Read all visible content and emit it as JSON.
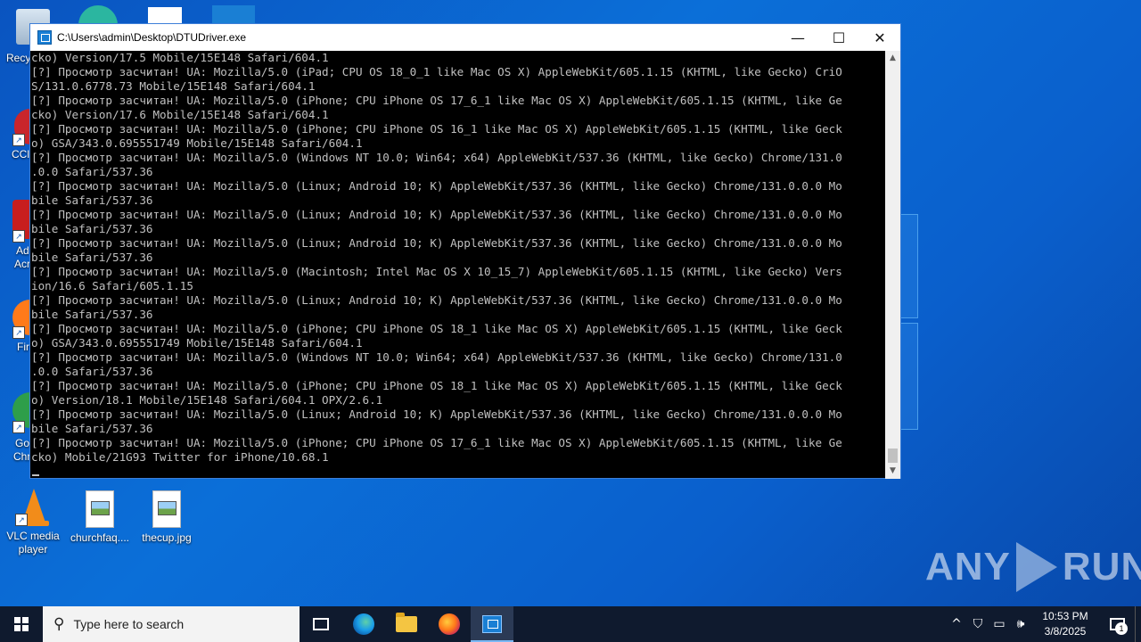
{
  "window": {
    "title": "C:\\Users\\admin\\Desktop\\DTUDriver.exe",
    "minimize_glyph": "—",
    "maximize_glyph": "☐",
    "close_glyph": "✕"
  },
  "console": {
    "lines": [
      "cko) Version/17.5 Mobile/15E148 Safari/604.1",
      "[?] Просмотр засчитан! UA: Mozilla/5.0 (iPad; CPU OS 18_0_1 like Mac OS X) AppleWebKit/605.1.15 (KHTML, like Gecko) CriO",
      "S/131.0.6778.73 Mobile/15E148 Safari/604.1",
      "[?] Просмотр засчитан! UA: Mozilla/5.0 (iPhone; CPU iPhone OS 17_6_1 like Mac OS X) AppleWebKit/605.1.15 (KHTML, like Ge",
      "cko) Version/17.6 Mobile/15E148 Safari/604.1",
      "[?] Просмотр засчитан! UA: Mozilla/5.0 (iPhone; CPU iPhone OS 16_1 like Mac OS X) AppleWebKit/605.1.15 (KHTML, like Geck",
      "o) GSA/343.0.695551749 Mobile/15E148 Safari/604.1",
      "[?] Просмотр засчитан! UA: Mozilla/5.0 (Windows NT 10.0; Win64; x64) AppleWebKit/537.36 (KHTML, like Gecko) Chrome/131.0",
      ".0.0 Safari/537.36",
      "[?] Просмотр засчитан! UA: Mozilla/5.0 (Linux; Android 10; K) AppleWebKit/537.36 (KHTML, like Gecko) Chrome/131.0.0.0 Mo",
      "bile Safari/537.36",
      "[?] Просмотр засчитан! UA: Mozilla/5.0 (Linux; Android 10; K) AppleWebKit/537.36 (KHTML, like Gecko) Chrome/131.0.0.0 Mo",
      "bile Safari/537.36",
      "[?] Просмотр засчитан! UA: Mozilla/5.0 (Linux; Android 10; K) AppleWebKit/537.36 (KHTML, like Gecko) Chrome/131.0.0.0 Mo",
      "bile Safari/537.36",
      "[?] Просмотр засчитан! UA: Mozilla/5.0 (Macintosh; Intel Mac OS X 10_15_7) AppleWebKit/605.1.15 (KHTML, like Gecko) Vers",
      "ion/16.6 Safari/605.1.15",
      "[?] Просмотр засчитан! UA: Mozilla/5.0 (Linux; Android 10; K) AppleWebKit/537.36 (KHTML, like Gecko) Chrome/131.0.0.0 Mo",
      "bile Safari/537.36",
      "[?] Просмотр засчитан! UA: Mozilla/5.0 (iPhone; CPU iPhone OS 18_1 like Mac OS X) AppleWebKit/605.1.15 (KHTML, like Geck",
      "o) GSA/343.0.695551749 Mobile/15E148 Safari/604.1",
      "[?] Просмотр засчитан! UA: Mozilla/5.0 (Windows NT 10.0; Win64; x64) AppleWebKit/537.36 (KHTML, like Gecko) Chrome/131.0",
      ".0.0 Safari/537.36",
      "[?] Просмотр засчитан! UA: Mozilla/5.0 (iPhone; CPU iPhone OS 18_1 like Mac OS X) AppleWebKit/605.1.15 (KHTML, like Geck",
      "o) Version/18.1 Mobile/15E148 Safari/604.1 OPX/2.6.1",
      "[?] Просмотр засчитан! UA: Mozilla/5.0 (Linux; Android 10; K) AppleWebKit/537.36 (KHTML, like Gecko) Chrome/131.0.0.0 Mo",
      "bile Safari/537.36",
      "[?] Просмотр засчитан! UA: Mozilla/5.0 (iPhone; CPU iPhone OS 17_6_1 like Mac OS X) AppleWebKit/605.1.15 (KHTML, like Ge",
      "cko) Mobile/21G93 Twitter for iPhone/10.68.1"
    ]
  },
  "desktop": {
    "icons": [
      {
        "label": "VLC media player"
      },
      {
        "label": "churchfaq...."
      },
      {
        "label": "thecup.jpg"
      }
    ],
    "partial_labels": [
      "Recycl",
      "CCl",
      "Ad",
      "Acr",
      "Fir",
      "Go",
      "Chro"
    ]
  },
  "watermark": {
    "left": "ANY",
    "right": "RUN"
  },
  "taskbar": {
    "search_placeholder": "Type here to search",
    "clock_time": "10:53 PM",
    "clock_date": "3/8/2025",
    "notification_count": "1",
    "tray_chevron": "^"
  }
}
